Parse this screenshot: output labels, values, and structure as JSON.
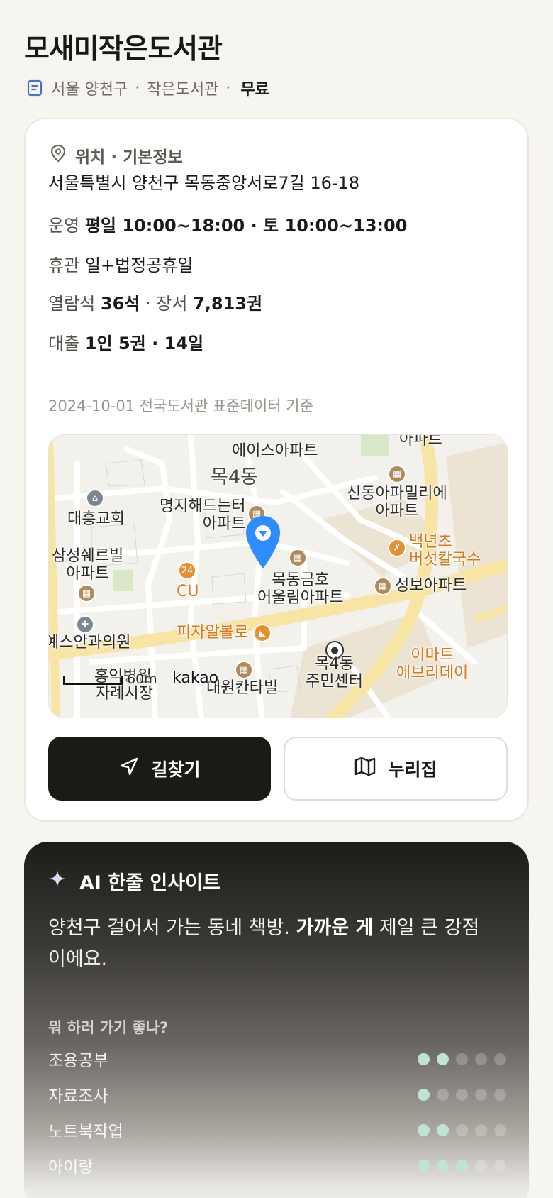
{
  "library": {
    "name": "모새미작은도서관",
    "region": "서울 양천구",
    "type": "작은도서관",
    "fee": "무료",
    "sep": "·"
  },
  "info": {
    "section_title": "위치 · 기본정보",
    "address": "서울특별시 양천구 목동중앙서로7길 16-18",
    "hours_label": "운영",
    "hours_value": "평일 10:00~18:00 · 토 10:00~13:00",
    "closed_label": "휴관",
    "closed_value": "일+법정공휴일",
    "seats_label": "열람석",
    "seats_value": "36석",
    "books_label": "· 장서",
    "books_value": "7,813권",
    "loan_label": "대출",
    "loan_value": "1인 5권 · 14일",
    "source": "2024-10-01 전국도서관 표준데이터 기준"
  },
  "map": {
    "labels": {
      "ace_apt": "에이스아파트",
      "apt_top": "아파트",
      "mok4dong": "목4동",
      "sindong": "신동아파밀리에\n아파트",
      "myeongji": "명지해드는터\n아파트",
      "daeheung": "대흥교회",
      "baeknyeon": "백년초\n버섯칼국수",
      "samsung": "삼성쉐르빌\n아파트",
      "cu": "CU",
      "mokdong_kumho": "목동금호\n어울림아파트",
      "seongbo": "성보아파트",
      "clinic": "예스안과의원",
      "pizza": "피자알볼로",
      "center": "목4동\n주민센터",
      "emart": "이마트\n에브리데이",
      "hospital": "홍익병원",
      "market": "자례시장",
      "daewon": "대원칸타빌",
      "scale": "60m",
      "brand": "kakao"
    },
    "pin_color": "#2f8cff"
  },
  "actions": {
    "directions": "길찾기",
    "nurizip": "누리집"
  },
  "ai": {
    "title": "AI 한줄 인사이트",
    "text_pre": "양천구 걸어서 가는 동네 책방.",
    "text_bold": "가까운 게",
    "text_post": "제일 큰 강점이에요.",
    "sub_title": "뭐 하러 가기 좋나?",
    "ratings": [
      {
        "label": "조용공부",
        "score": 2,
        "max": 5
      },
      {
        "label": "자료조사",
        "score": 1,
        "max": 5
      },
      {
        "label": "노트북작업",
        "score": 2,
        "max": 5
      },
      {
        "label": "아이랑",
        "score": 3,
        "max": 5
      }
    ],
    "accent": "#bfe3d7"
  }
}
